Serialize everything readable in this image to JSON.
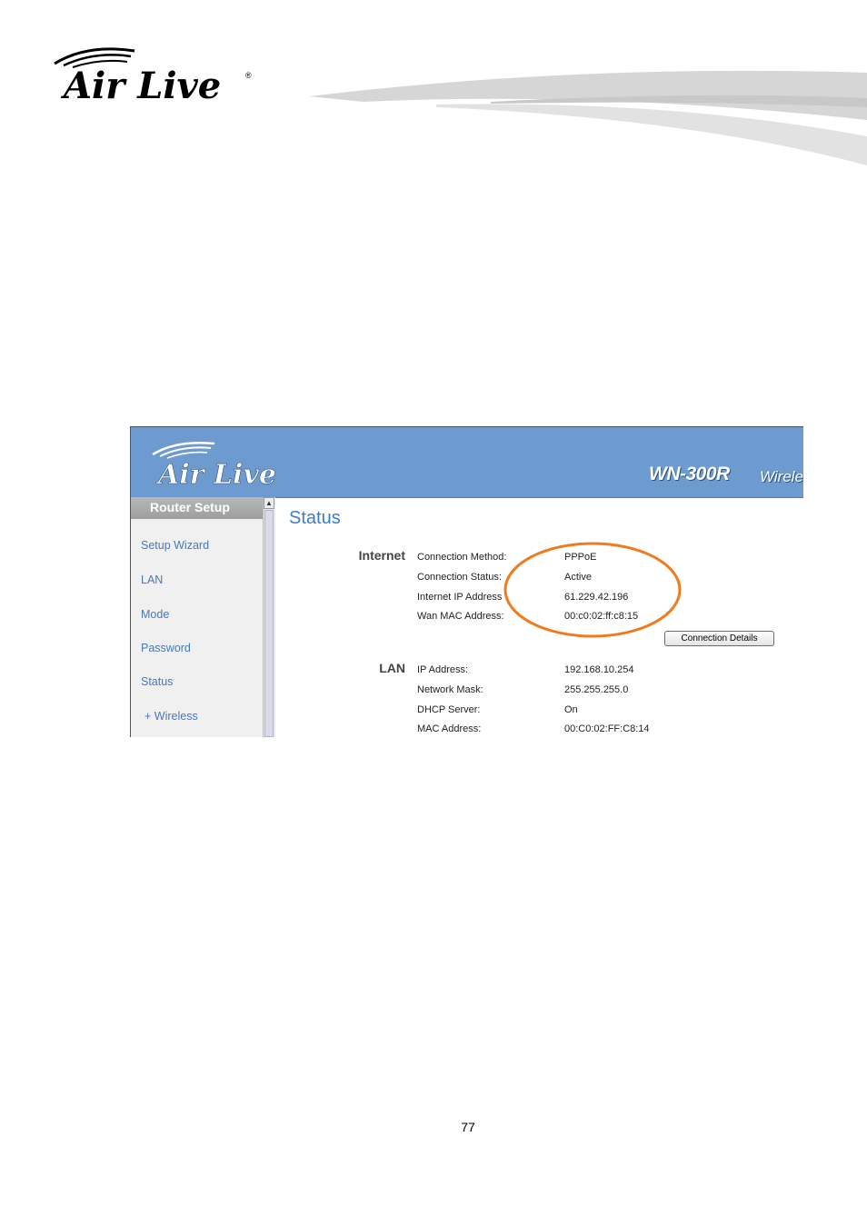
{
  "page": {
    "brand": "Air Live",
    "page_number": "77"
  },
  "router_ui": {
    "banner": {
      "brand": "Air Live",
      "model": "WN-300R",
      "subtitle": "Wirele"
    },
    "sidebar": {
      "header": "Router Setup",
      "items": [
        {
          "label": "Setup Wizard"
        },
        {
          "label": "LAN"
        },
        {
          "label": "Mode"
        },
        {
          "label": "Password"
        },
        {
          "label": "Status"
        },
        {
          "label": "+ Wireless"
        }
      ]
    },
    "main": {
      "title": "Status",
      "internet": {
        "section_label": "Internet",
        "rows": [
          {
            "label": "Connection Method:",
            "value": "PPPoE"
          },
          {
            "label": "Connection Status:",
            "value": "Active"
          },
          {
            "label": "Internet IP Address",
            "value": "61.229.42.196"
          },
          {
            "label": "Wan MAC Address:",
            "value": "00:c0:02:ff:c8:15"
          }
        ],
        "details_button": "Connection Details"
      },
      "lan": {
        "section_label": "LAN",
        "rows": [
          {
            "label": "IP Address:",
            "value": "192.168.10.254"
          },
          {
            "label": "Network Mask:",
            "value": "255.255.255.0"
          },
          {
            "label": "DHCP Server:",
            "value": "On"
          },
          {
            "label": "MAC Address:",
            "value": "00:C0:02:FF:C8:14"
          }
        ]
      }
    }
  },
  "colors": {
    "banner": "#6d9bd0",
    "link": "#4878b8",
    "title": "#3c7ec6",
    "highlight": "#f07b1e"
  }
}
